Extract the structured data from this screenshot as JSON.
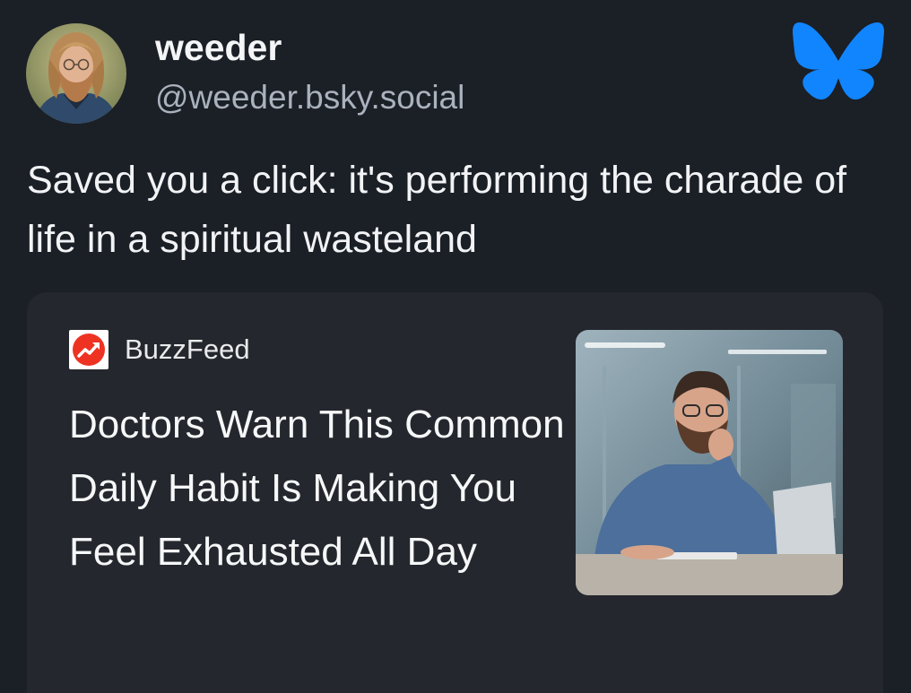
{
  "author": {
    "display_name": "weeder",
    "handle": "@weeder.bsky.social",
    "avatar_icon": "avatar-photo"
  },
  "platform_logo": "bluesky-butterfly-icon",
  "post": {
    "text": "Saved you a click: it's performing the charade of life in a spiritual wasteland"
  },
  "link_card": {
    "source_icon": "buzzfeed-trending-icon",
    "source_name": "BuzzFeed",
    "headline": "Doctors Warn This Common Daily Habit Is Making You Feel Exhausted All Day",
    "thumbnail": "man-yawning-at-laptop-photo"
  },
  "colors": {
    "background": "#1b1f26",
    "card_background": "#24272d",
    "handle_text": "#aab2bd",
    "bluesky_blue": "#1185fe",
    "buzzfeed_red": "#ee3322"
  }
}
